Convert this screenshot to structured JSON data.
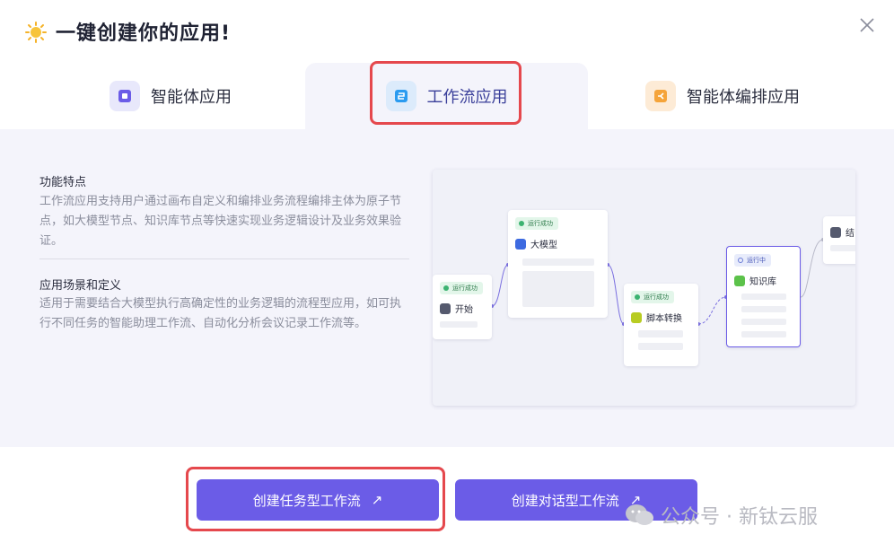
{
  "header": {
    "title": "一键创建你的应用!"
  },
  "tabs": [
    {
      "label": "智能体应用",
      "icon": "agent-app-icon",
      "active": false
    },
    {
      "label": "工作流应用",
      "icon": "workflow-app-icon",
      "active": true
    },
    {
      "label": "智能体编排应用",
      "icon": "agent-orchestration-icon",
      "active": false
    }
  ],
  "features": {
    "title": "功能特点",
    "desc": "工作流应用支持用户通过画布自定义和编排业务流程编排主体为原子节点，如大模型节点、知识库节点等快速实现业务逻辑设计及业务效果验证。"
  },
  "scenarios": {
    "title": "应用场景和定义",
    "desc": "适用于需要结合大模型执行高确定性的业务逻辑的流程型应用，如可执行不同任务的智能助理工作流、自动化分析会议记录工作流等。"
  },
  "flow": {
    "status_success": "运行成功",
    "status_running": "运行中",
    "nodes": {
      "start": "开始",
      "llm": "大模型",
      "script": "脚本转换",
      "knowledge": "知识库",
      "end": "结"
    }
  },
  "buttons": {
    "task_workflow": "创建任务型工作流",
    "chat_workflow": "创建对话型工作流",
    "arrow": "↗"
  },
  "watermark": {
    "text": "公众号 · 新钛云服"
  },
  "colors": {
    "accent": "#6b5ce7",
    "highlight": "#e5484d",
    "panel": "#f4f4fb"
  }
}
